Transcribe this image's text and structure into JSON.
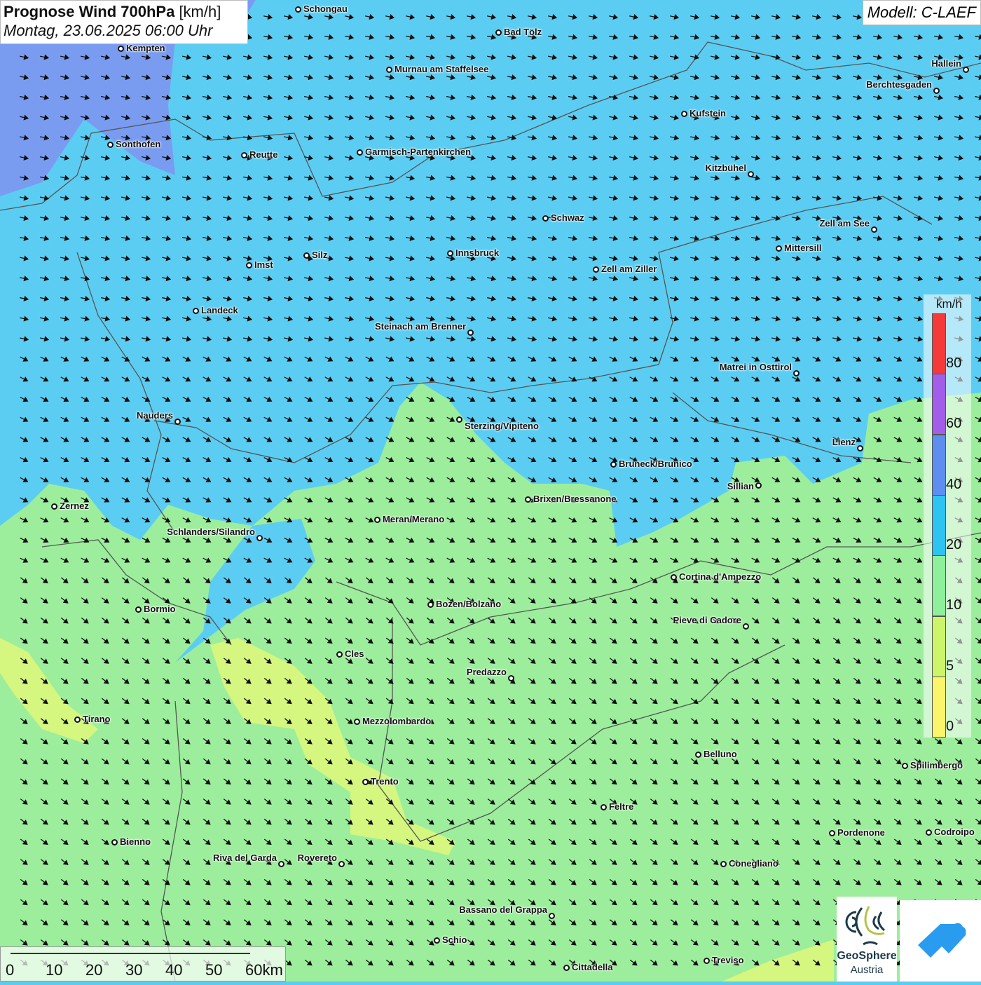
{
  "header": {
    "title": "Prognose Wind 700hPa",
    "unit": "[km/h]",
    "datetime": "Montag, 23.06.2025 06:00 Uhr",
    "model": "Modell: C-LAEF"
  },
  "legend": {
    "unit": "km/h",
    "ticks": [
      "80",
      "60",
      "40",
      "20",
      "10",
      "5",
      "0"
    ],
    "colors": [
      "#f53a3a",
      "#a25ee8",
      "#5e8ff0",
      "#2ec4f2",
      "#8ef09a",
      "#ccf56a",
      "#fbf56c"
    ]
  },
  "scale": {
    "labels": [
      "0",
      "10",
      "20",
      "30",
      "40",
      "50",
      "60km"
    ]
  },
  "logos": {
    "geosphere": "GeoSphere",
    "austria": "Austria"
  },
  "colors": {
    "fast": "#5ccdf2",
    "slow": "#9cee9c",
    "calm": "#dff77a",
    "strong": "#7a9cf0"
  },
  "cities": [
    "Schongau",
    "Bad Tölz",
    "Kempten",
    "Murnau am Staffelsee",
    "Hallein",
    "Berchtesgaden",
    "Kufstein",
    "Sonthofen",
    "Reutte",
    "Garmisch-Partenkirchen",
    "Kitzbühel",
    "Schwaz",
    "Zell am See",
    "Mittersill",
    "Innsbruck",
    "Silz",
    "Imst",
    "Zell am Ziller",
    "Landeck",
    "Steinach am Brenner",
    "Matrei in Osttirol",
    "Nauders",
    "Sterzing/Vipiteno",
    "Lienz",
    "Bruneck/Brunico",
    "Sillian",
    "Brixen/Bressanone",
    "Zernez",
    "Meran/Merano",
    "Schlanders/Silandro",
    "Cortina d'Ampezzo",
    "Bozen/Bolzano",
    "Bormio",
    "Pieve di Cadore",
    "Cles",
    "Predazzo",
    "Tirano",
    "Mezzolombardo",
    "Belluno",
    "Spilimbergo",
    "Trento",
    "Feltre",
    "Pordenone",
    "Codroipo",
    "Bienno",
    "Riva del Garda",
    "Rovereto",
    "Conegliano",
    "Bassano del Grappa",
    "Schio",
    "Treviso",
    "Cittadella"
  ]
}
